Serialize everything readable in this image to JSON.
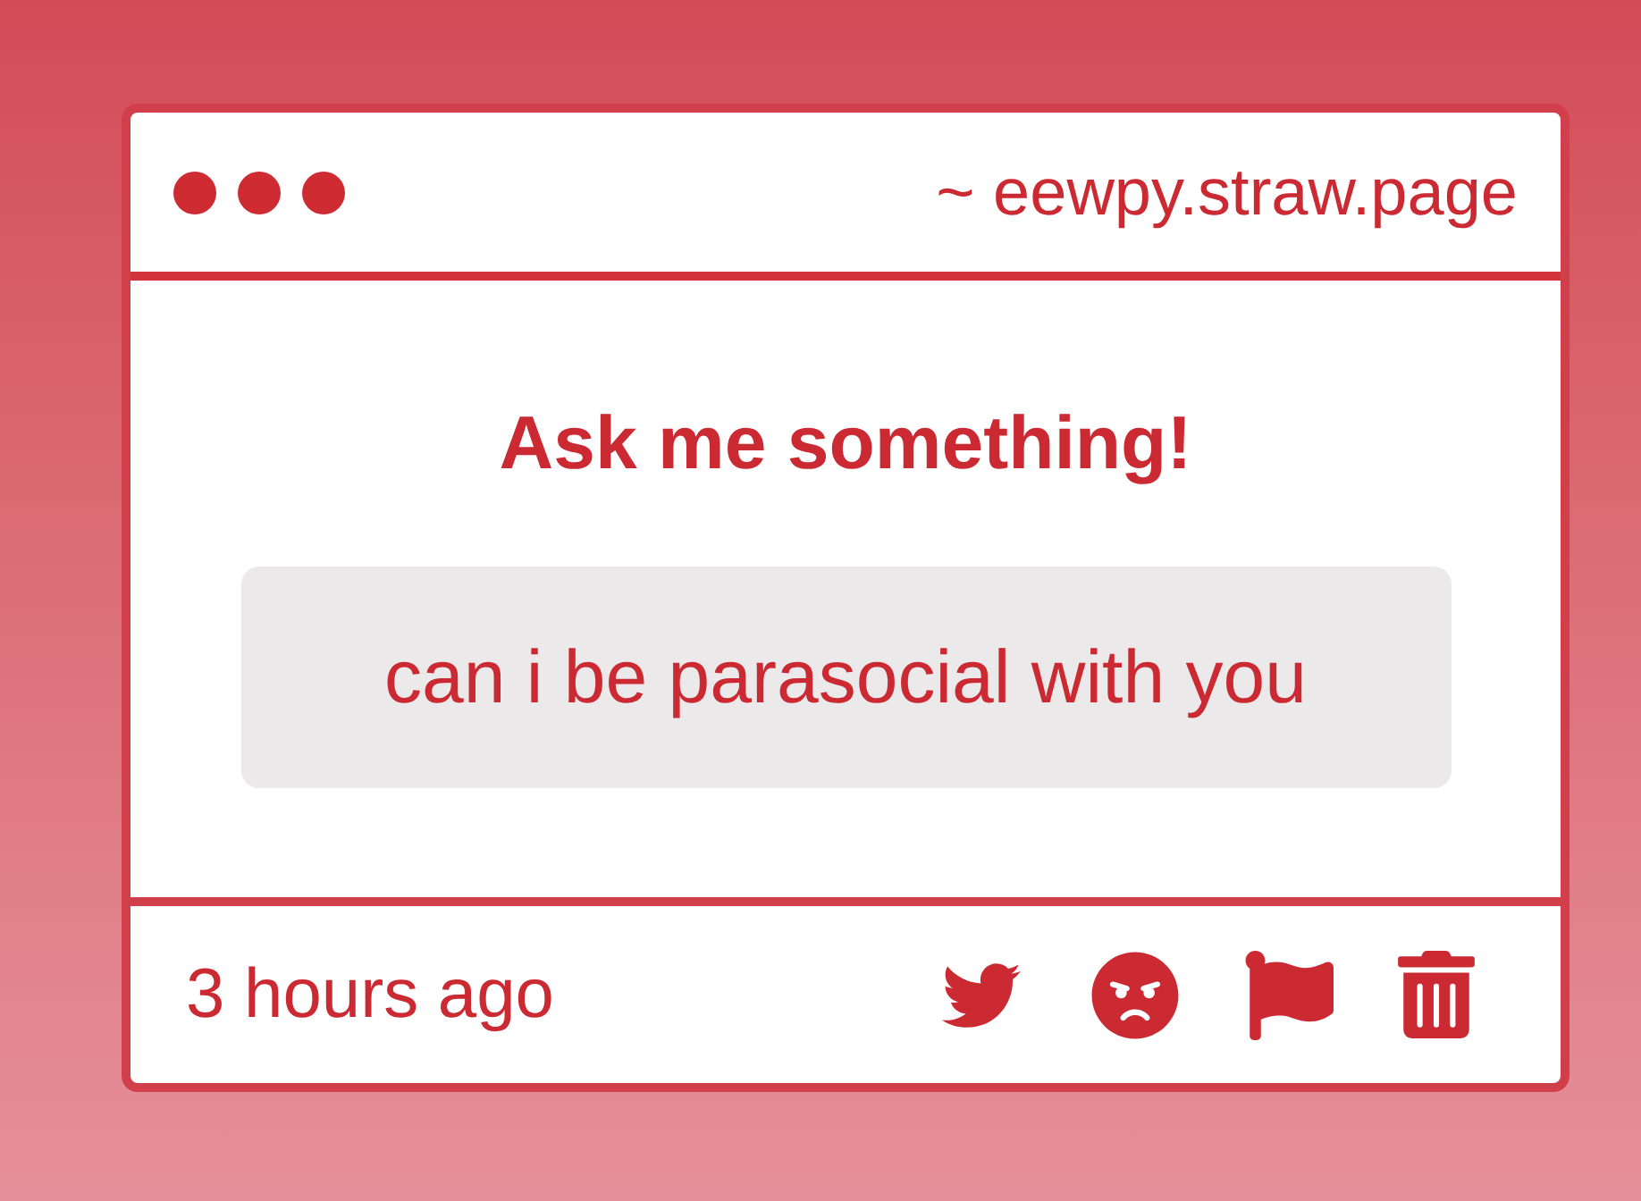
{
  "window": {
    "address": "~ eewpy.straw.page"
  },
  "prompt": {
    "title": "Ask me something!"
  },
  "question": {
    "text": "can i be parasocial with you"
  },
  "footer": {
    "time": "3 hours ago",
    "actions": [
      {
        "kind": "bird"
      },
      {
        "kind": "angry"
      },
      {
        "kind": "flag"
      },
      {
        "kind": "trash"
      }
    ]
  }
}
